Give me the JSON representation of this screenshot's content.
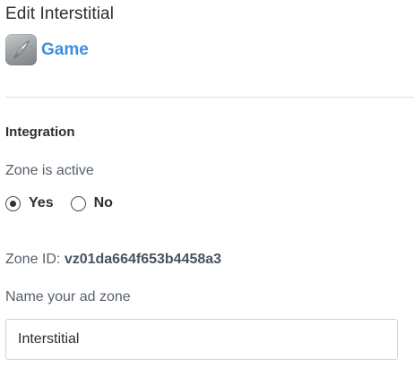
{
  "header": {
    "title": "Edit Interstitial"
  },
  "app": {
    "name": "Game",
    "icon": "app-icon"
  },
  "integration": {
    "heading": "Integration",
    "zone_active_label": "Zone is active",
    "options": [
      {
        "label": "Yes",
        "selected": true
      },
      {
        "label": "No",
        "selected": false
      }
    ],
    "zone_id_label": "Zone ID:",
    "zone_id_value": "vz01da664f653b4458a3",
    "name_label": "Name your ad zone",
    "name_value": "Interstitial"
  },
  "colors": {
    "link": "#3d8ee0",
    "divider": "#dcdfe2",
    "input_border": "#cfd4d9"
  }
}
